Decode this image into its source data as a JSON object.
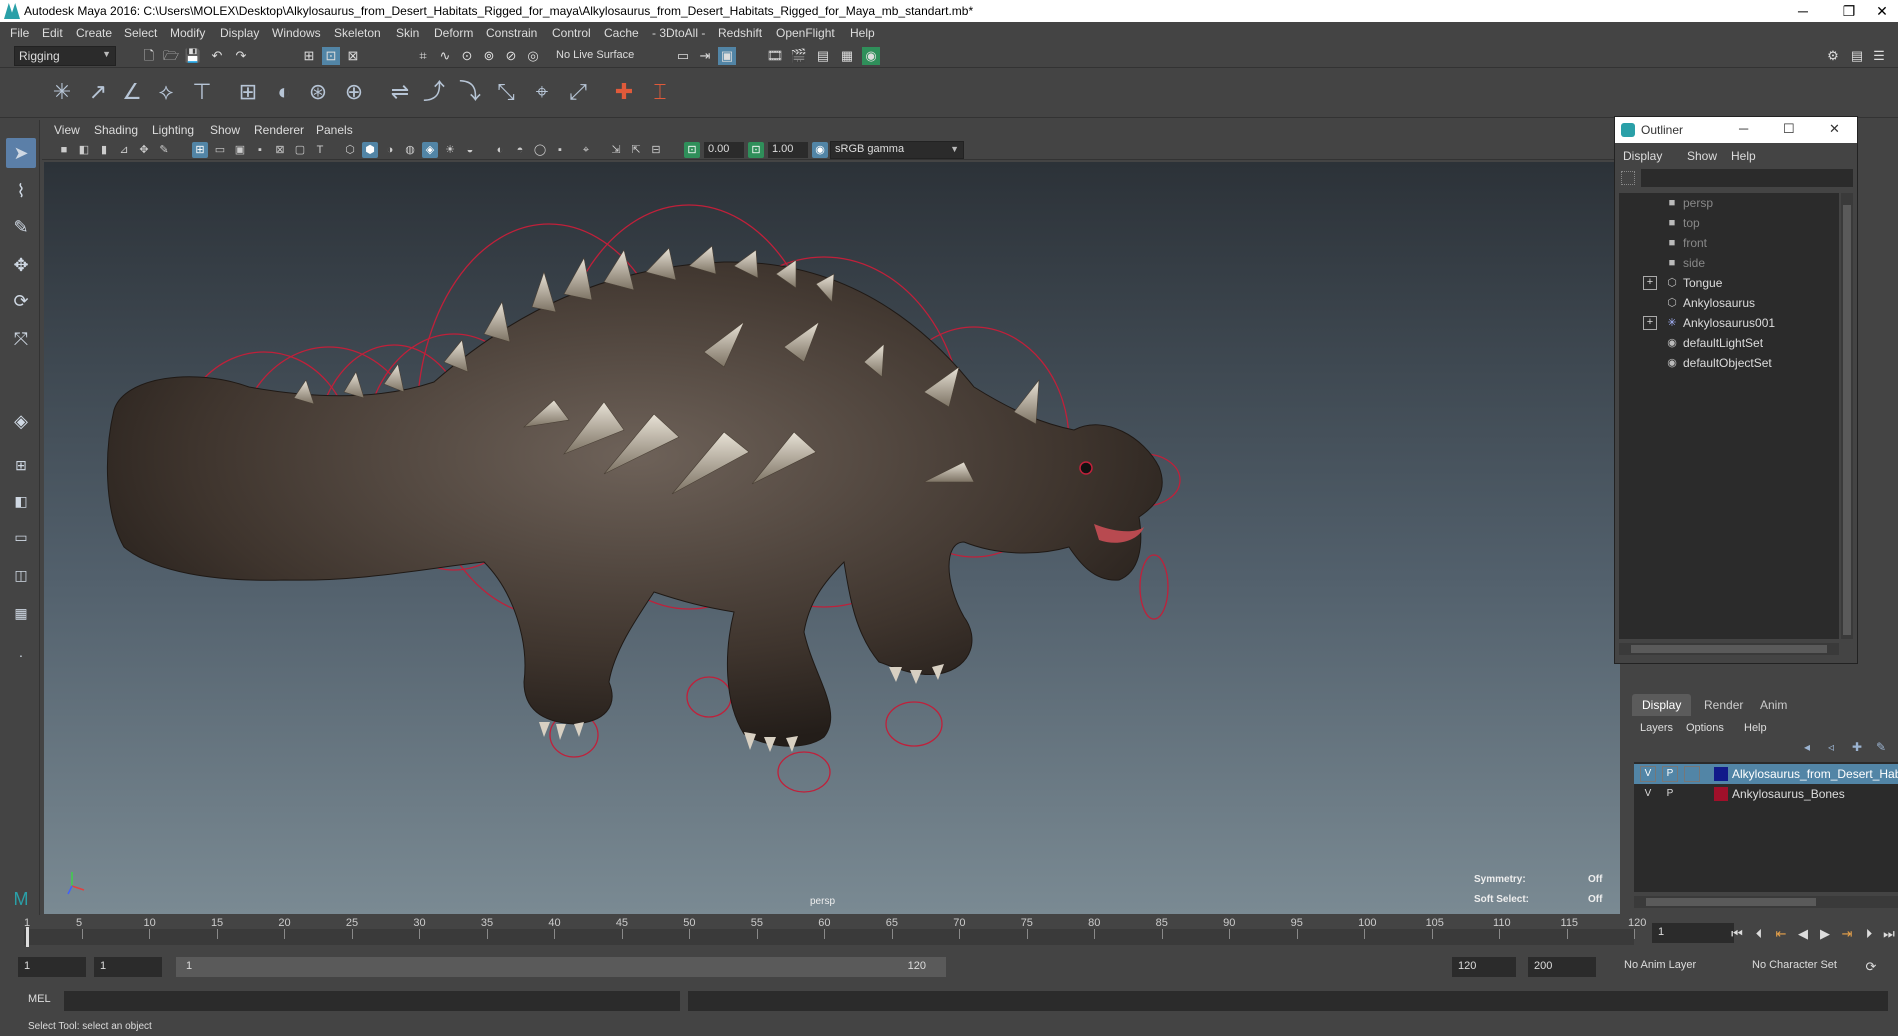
{
  "window": {
    "title": "Autodesk Maya 2016: C:\\Users\\MOLEX\\Desktop\\Alkylosaurus_from_Desert_Habitats_Rigged_for_maya\\Alkylosaurus_from_Desert_Habitats_Rigged_for_Maya_mb_standart.mb*",
    "minimize": "─",
    "restore": "❐",
    "close": "✕"
  },
  "menubar": [
    "File",
    "Edit",
    "Create",
    "Select",
    "Modify",
    "Display",
    "Windows",
    "Skeleton",
    "Skin",
    "Deform",
    "Constrain",
    "Control",
    "Cache",
    "- 3DtoAll -",
    "Redshift",
    "OpenFlight",
    "Help"
  ],
  "statusline": {
    "menuset": "Rigging",
    "live_surface": "No Live Surface"
  },
  "panel": {
    "menus": [
      "View",
      "Shading",
      "Lighting",
      "Show",
      "Renderer",
      "Panels"
    ],
    "exposure": "0.00",
    "gamma": "1.00",
    "color_space": "sRGB gamma"
  },
  "viewport": {
    "camera": "persp",
    "symmetry_label": "Symmetry:",
    "symmetry_value": "Off",
    "soft_select_label": "Soft Select:",
    "soft_select_value": "Off",
    "rig_color": "#c0203a"
  },
  "outliner": {
    "title": "Outliner",
    "menus": [
      "Display",
      "Show",
      "Help"
    ],
    "items": [
      {
        "label": "persp",
        "icon": "camera-icon",
        "dim": true
      },
      {
        "label": "top",
        "icon": "camera-icon",
        "dim": true
      },
      {
        "label": "front",
        "icon": "camera-icon",
        "dim": true
      },
      {
        "label": "side",
        "icon": "camera-icon",
        "dim": true
      },
      {
        "label": "Tongue",
        "icon": "mesh-icon",
        "expandable": true
      },
      {
        "label": "Ankylosaurus",
        "icon": "mesh-icon"
      },
      {
        "label": "Ankylosaurus001",
        "icon": "joint-icon",
        "expandable": true
      },
      {
        "label": "defaultLightSet",
        "icon": "set-icon"
      },
      {
        "label": "defaultObjectSet",
        "icon": "set-icon"
      }
    ]
  },
  "layer_editor": {
    "tabs": [
      "Display",
      "Render",
      "Anim"
    ],
    "menus": [
      "Layers",
      "Options",
      "Help"
    ],
    "layers": [
      {
        "v": "V",
        "p": "P",
        "name": "Alkylosaurus_from_Desert_Habit",
        "color": "#101a8a",
        "selected": true
      },
      {
        "v": "V",
        "p": "P",
        "name": "Ankylosaurus_Bones",
        "color": "#a0102a",
        "selected": false
      }
    ]
  },
  "timeline": {
    "ticks": [
      "5",
      "10",
      "15",
      "20",
      "25",
      "30",
      "35",
      "40",
      "45",
      "50",
      "55",
      "60",
      "65",
      "70",
      "75",
      "80",
      "85",
      "90",
      "95",
      "100",
      "105",
      "110",
      "115",
      "120"
    ],
    "start_tick": "1",
    "current_frame": "1"
  },
  "range": {
    "start": "1",
    "playback_start": "1",
    "slider_start": "1",
    "slider_end": "120",
    "playback_end": "120",
    "end": "200",
    "anim_layer": "No Anim Layer",
    "character_set": "No Character Set"
  },
  "mel": {
    "label": "MEL"
  },
  "helpline": "Select Tool: select an object"
}
